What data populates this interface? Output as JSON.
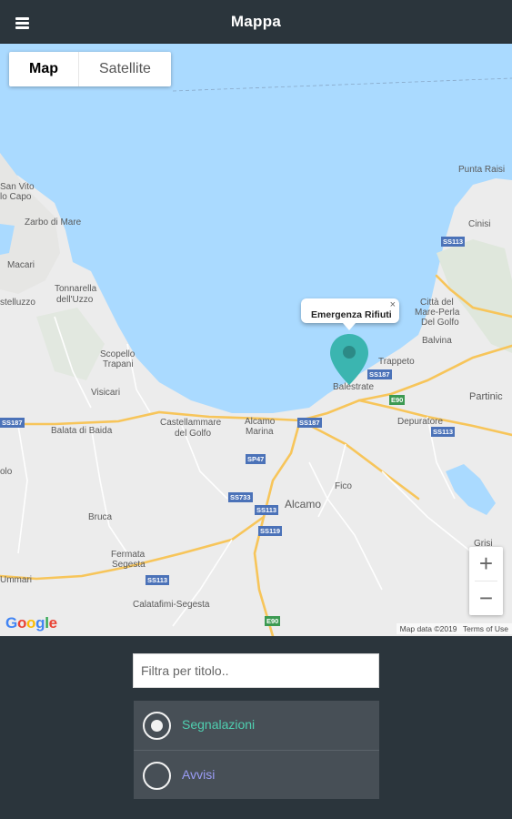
{
  "app": {
    "title": "Mappa"
  },
  "header": {
    "menu_icon": "hamburger-menu-icon"
  },
  "map": {
    "type_control": {
      "map_label": "Map",
      "satellite_label": "Satellite",
      "selected": "Map"
    },
    "zoom": {
      "in_label": "+",
      "out_label": "−"
    },
    "info_window": {
      "title": "Emergenza Rifiuti",
      "close_label": "×"
    },
    "marker": {
      "icon": "map-pin-icon",
      "color": "#3bb5b0"
    },
    "google_logo": {
      "g1": "G",
      "o1": "o",
      "o2": "o",
      "g2": "g",
      "l": "l",
      "e": "e"
    },
    "attribution": {
      "data": "Map data ©2019",
      "terms": "Terms of Use"
    },
    "places": {
      "punta_raisi": "Punta Raisi",
      "san_vito": "San Vito",
      "lo_capo": "lo Capo",
      "zarbo": "Zarbo di Mare",
      "macari": "Macari",
      "castelluzzo": "stelluzzo",
      "tonnarella": "Tonnarella",
      "dell_uzzo": "dell'Uzzo",
      "cinisi": "Cinisi",
      "citta_del": "Città del",
      "mare_perla": "Mare-Perla",
      "del_golfo": "Del Golfo",
      "balvina": "Balvina",
      "trappeto": "Trappeto",
      "scopello": "Scopello",
      "trapani": "Trapani",
      "visicari": "Visicari",
      "balata": "Balata di Baida",
      "castellammare": "Castellammare",
      "del_golfo2": "del Golfo",
      "alcamo_marina1": "Alcamo",
      "alcamo_marina2": "Marina",
      "balestrate": "Balestrate",
      "partinico": "Partinic",
      "depuratore": "Depuratore",
      "fico": "Fico",
      "alcamo": "Alcamo",
      "bruca": "Bruca",
      "fermata1": "Fermata",
      "fermata2": "Segesta",
      "calatafimi": "Calatafimi-Segesta",
      "grisi": "Grisi",
      "ummari": "Ummari",
      "olo": "olo"
    },
    "roads": {
      "ss113_a": "SS113",
      "ss187_a": "SS187",
      "ss187_b": "SS187",
      "e90_a": "E90",
      "ss113_b": "SS113",
      "ss187_c": "SS187",
      "sp47": "SP47",
      "ss733": "SS733",
      "ss113_c": "SS113",
      "ss119": "SS119",
      "ss113_d": "SS113",
      "e90_b": "E90"
    }
  },
  "filter": {
    "placeholder": "Filtra per titolo..",
    "value": ""
  },
  "radio": {
    "options": [
      {
        "label": "Segnalazioni",
        "color": "#4fcfb0",
        "selected": true
      },
      {
        "label": "Avvisi",
        "color": "#9a9cf5",
        "selected": false
      }
    ]
  },
  "colors": {
    "header_bg": "#2b353c",
    "panel_bg": "#474f56",
    "water": "#aadaff",
    "land": "#ececec"
  }
}
